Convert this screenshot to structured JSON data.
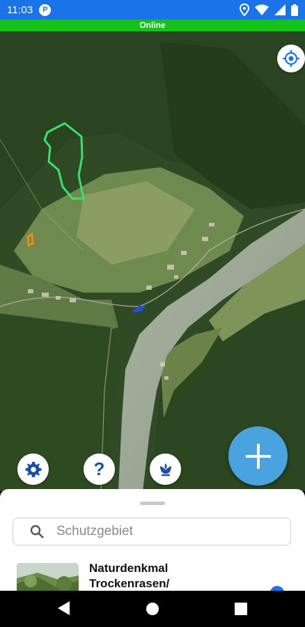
{
  "status_bar": {
    "time": "11:03",
    "badge": "P"
  },
  "connection": {
    "label": "Online"
  },
  "map_controls": {
    "help_label": "?",
    "add_label": "+"
  },
  "search": {
    "placeholder": "Schutzgebiet",
    "value": ""
  },
  "results": [
    {
      "title_line1": "Naturdenkmal",
      "title_line2": "Trockenrasen/"
    }
  ],
  "colors": {
    "status_bar": "#1a73e8",
    "online": "#14c219",
    "fab": "#4aa3df",
    "icon_blue": "#1a4fa3"
  },
  "icons": [
    "location-icon",
    "wifi-icon",
    "signal-icon",
    "battery-icon",
    "locate-icon",
    "gear-icon",
    "help-icon",
    "flower-icon",
    "plus-icon",
    "search-icon",
    "back-icon",
    "home-icon",
    "recents-icon"
  ]
}
